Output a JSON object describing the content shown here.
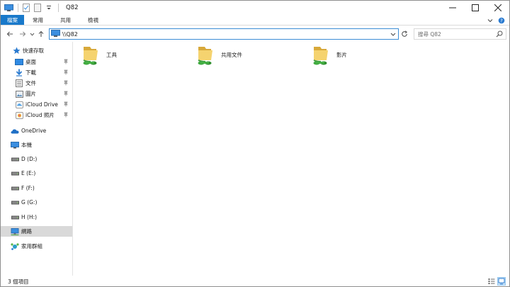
{
  "window": {
    "title": "Q82"
  },
  "ribbon": {
    "tabs": [
      "檔案",
      "常用",
      "共用",
      "檢視"
    ]
  },
  "address": {
    "path": "\\\\Q82"
  },
  "search": {
    "placeholder": "搜尋 Q82"
  },
  "navpane": {
    "quick_access": "快速存取",
    "quick_items": [
      {
        "label": "桌面",
        "icon": "desktop-icon"
      },
      {
        "label": "下載",
        "icon": "download-icon"
      },
      {
        "label": "文件",
        "icon": "documents-icon"
      },
      {
        "label": "圖片",
        "icon": "pictures-icon"
      },
      {
        "label": "iCloud Drive",
        "icon": "icloud-icon"
      },
      {
        "label": "iCloud 照片",
        "icon": "icloud-photos-icon"
      }
    ],
    "onedrive": "OneDrive",
    "this_pc": "本機",
    "drives": [
      "D (D:)",
      "E (E:)",
      "F (F:)",
      "G (G:)",
      "H (H:)"
    ],
    "network": "網路",
    "homegroup": "家用群組"
  },
  "content": {
    "folders": [
      {
        "label": "工具",
        "icon": "shared-folder-icon"
      },
      {
        "label": "共用文件",
        "icon": "shared-folder-icon"
      },
      {
        "label": "影片",
        "icon": "shared-folder-icon"
      }
    ]
  },
  "status": {
    "item_count": "3 個項目"
  },
  "colors": {
    "accent": "#1979ca",
    "selected_nav": "#d9d9d9",
    "address_border": "#3c8dd5"
  }
}
